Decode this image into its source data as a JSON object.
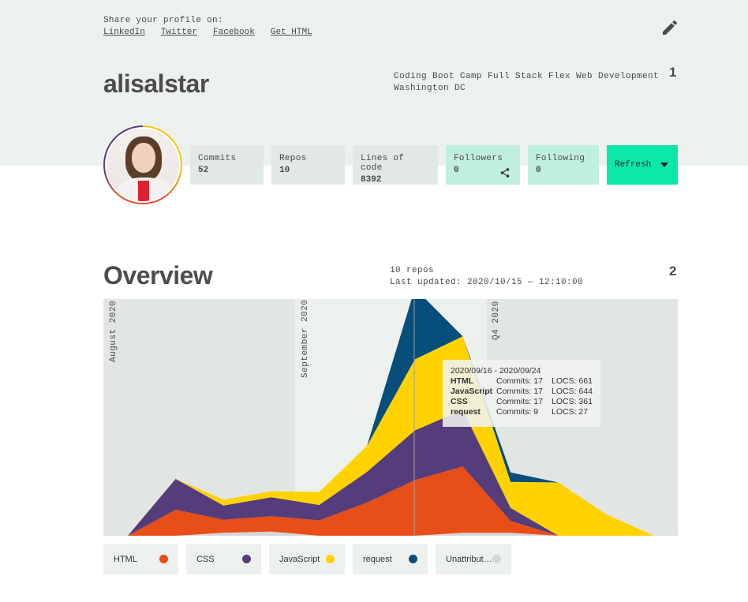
{
  "share": {
    "label": "Share your profile on:",
    "links": [
      "LinkedIn",
      "Twitter",
      "Facebook",
      "Get HTML"
    ]
  },
  "profile": {
    "username": "alisalstar",
    "bio_line1": "Coding Boot Camp Full Stack Flex Web Development",
    "bio_line2": "Washington DC",
    "section_number": "1"
  },
  "stats": [
    {
      "label": "Commits",
      "value": "52"
    },
    {
      "label": "Repos",
      "value": "10"
    },
    {
      "label": "Lines of code",
      "value": "8392"
    },
    {
      "label": "Followers",
      "value": "0"
    },
    {
      "label": "Following",
      "value": "0"
    }
  ],
  "refresh_label": "Refresh",
  "overview": {
    "title": "Overview",
    "repos": "10 repos",
    "updated": "Last updated: 2020/10/15 — 12:10:00",
    "section_number": "2"
  },
  "chart_data": {
    "type": "area",
    "stacked": true,
    "period_labels": [
      "August 2020",
      "September 2020",
      "Q4 2020"
    ],
    "x": [
      "2020/08/05",
      "2020/08/12",
      "2020/08/19",
      "2020/08/26",
      "2020/09/02",
      "2020/09/09",
      "2020/09/16",
      "2020/09/23",
      "2020/09/30",
      "2020/10/07",
      "2020/10/14",
      "2020/10/21"
    ],
    "series": [
      {
        "name": "Unattributed",
        "color": "#d6d6d6",
        "values": [
          0,
          0,
          25,
          35,
          0,
          0,
          0,
          25,
          25,
          0,
          0,
          0
        ]
      },
      {
        "name": "HTML",
        "color": "#e84e17",
        "values": [
          0,
          220,
          110,
          130,
          130,
          280,
          470,
          560,
          100,
          0,
          0,
          0
        ]
      },
      {
        "name": "CSS",
        "color": "#553c7b",
        "values": [
          0,
          260,
          120,
          160,
          130,
          260,
          420,
          480,
          110,
          0,
          0,
          0
        ]
      },
      {
        "name": "JavaScript",
        "color": "#ffd200",
        "values": [
          0,
          0,
          50,
          50,
          110,
          220,
          600,
          620,
          220,
          450,
          180,
          0
        ]
      },
      {
        "name": "request",
        "color": "#074e7a",
        "values": [
          0,
          0,
          0,
          0,
          0,
          0,
          600,
          0,
          80,
          0,
          0,
          0
        ]
      }
    ],
    "hover_index": 6
  },
  "tooltip": {
    "range": "2020/09/16 - 2020/09/24",
    "rows": [
      {
        "name": "HTML",
        "commits": "Commits: 17",
        "locs": "LOCS: 661"
      },
      {
        "name": "JavaScript",
        "commits": "Commits: 17",
        "locs": "LOCS: 644"
      },
      {
        "name": "CSS",
        "commits": "Commits: 17",
        "locs": "LOCS: 361"
      },
      {
        "name": "request",
        "commits": "Commits: 9",
        "locs": "LOCS: 27"
      }
    ]
  },
  "legend": [
    {
      "name": "HTML",
      "color": "#e84e17"
    },
    {
      "name": "CSS",
      "color": "#553c7b"
    },
    {
      "name": "JavaScript",
      "color": "#ffd200"
    },
    {
      "name": "request",
      "color": "#074e7a"
    },
    {
      "name": "Unattribut…",
      "color": "#d6d6d6"
    }
  ]
}
